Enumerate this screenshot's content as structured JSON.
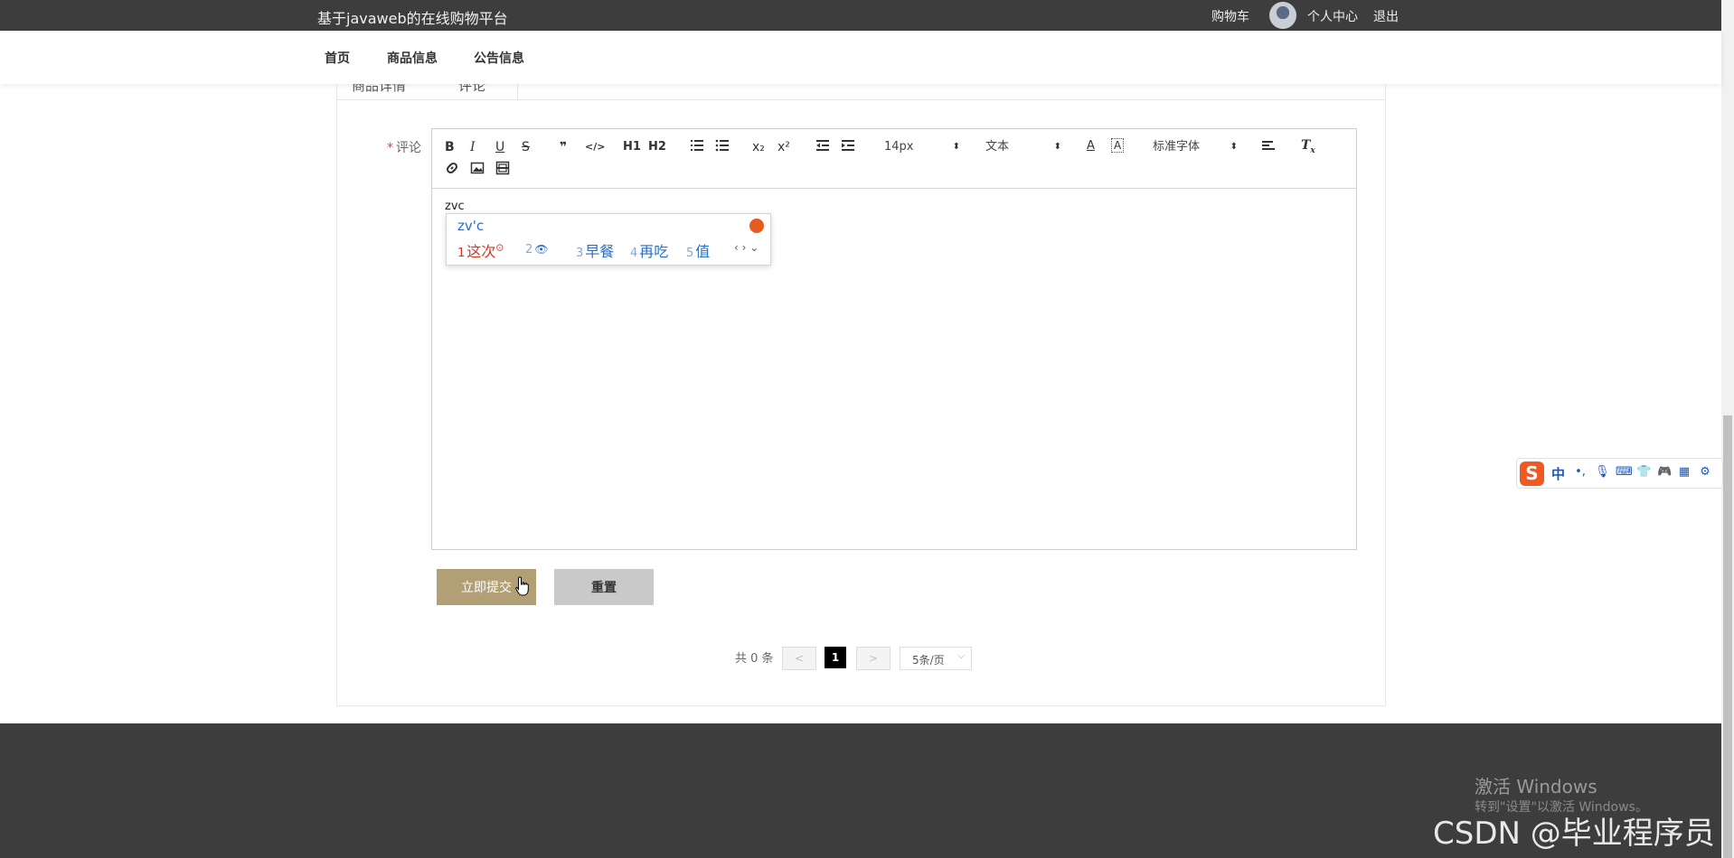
{
  "topbar": {
    "site_title": "基于javaweb的在线购物平台",
    "cart": "购物车",
    "user_center": "个人中心",
    "logout": "退出"
  },
  "nav": {
    "items": [
      "首页",
      "商品信息",
      "公告信息"
    ]
  },
  "tabs": [
    "商品详情",
    "评论"
  ],
  "form": {
    "comment_label": "评论",
    "required_mark": "*",
    "editor_text": "zvc",
    "submit_label": "立即提交",
    "reset_label": "重置"
  },
  "toolbar": {
    "bold": "B",
    "italic": "I",
    "underline": "U",
    "strike": "S",
    "quote": "❞",
    "code": "</>",
    "h1": "H1",
    "h2": "H2",
    "sub": "x₂",
    "sup": "x²",
    "font_size": "14px",
    "text_type": "文本",
    "font_family": "标准字体"
  },
  "ime": {
    "pinyin": "zv'c",
    "candidates": [
      {
        "num": "1",
        "text": "这次"
      },
      {
        "num": "2",
        "text": "👁"
      },
      {
        "num": "3",
        "text": "早餐"
      },
      {
        "num": "4",
        "text": "再吃"
      },
      {
        "num": "5",
        "text": "值"
      }
    ]
  },
  "pagination": {
    "total": "共 0 条",
    "prev": "<",
    "current": "1",
    "next": ">",
    "page_size": "5条/页"
  },
  "footer": {
    "watermark_title": "激活 Windows",
    "watermark_sub": "转到\"设置\"以激活 Windows。",
    "csdn": "CSDN @毕业程序员"
  },
  "sogou": {
    "logo": "S",
    "mode": "中"
  }
}
